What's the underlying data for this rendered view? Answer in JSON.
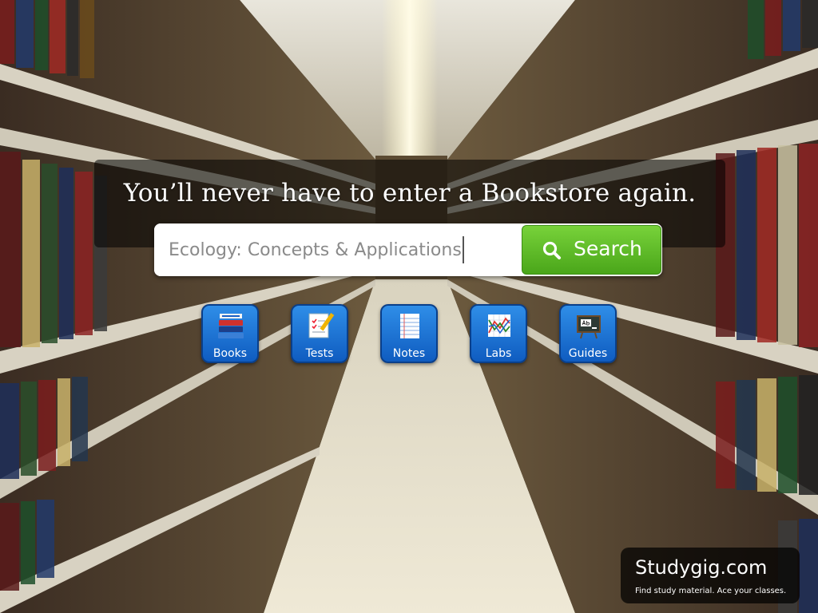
{
  "headline": "You’ll never have to enter a Bookstore again.",
  "search": {
    "value": "Ecology: Concepts & Applications",
    "button_label": "Search",
    "button_icon": "search-icon"
  },
  "categories": [
    {
      "label": "Books",
      "icon": "books-icon"
    },
    {
      "label": "Tests",
      "icon": "test-sheet-icon"
    },
    {
      "label": "Notes",
      "icon": "notepad-icon"
    },
    {
      "label": "Labs",
      "icon": "lab-chart-icon"
    },
    {
      "label": "Guides",
      "icon": "chalkboard-icon"
    }
  ],
  "branding": {
    "name": "Studygig.com",
    "tagline": "Find study material.  Ace your classes."
  },
  "colors": {
    "accent_green": "#5cb82a",
    "icon_blue": "#1f76d8"
  }
}
